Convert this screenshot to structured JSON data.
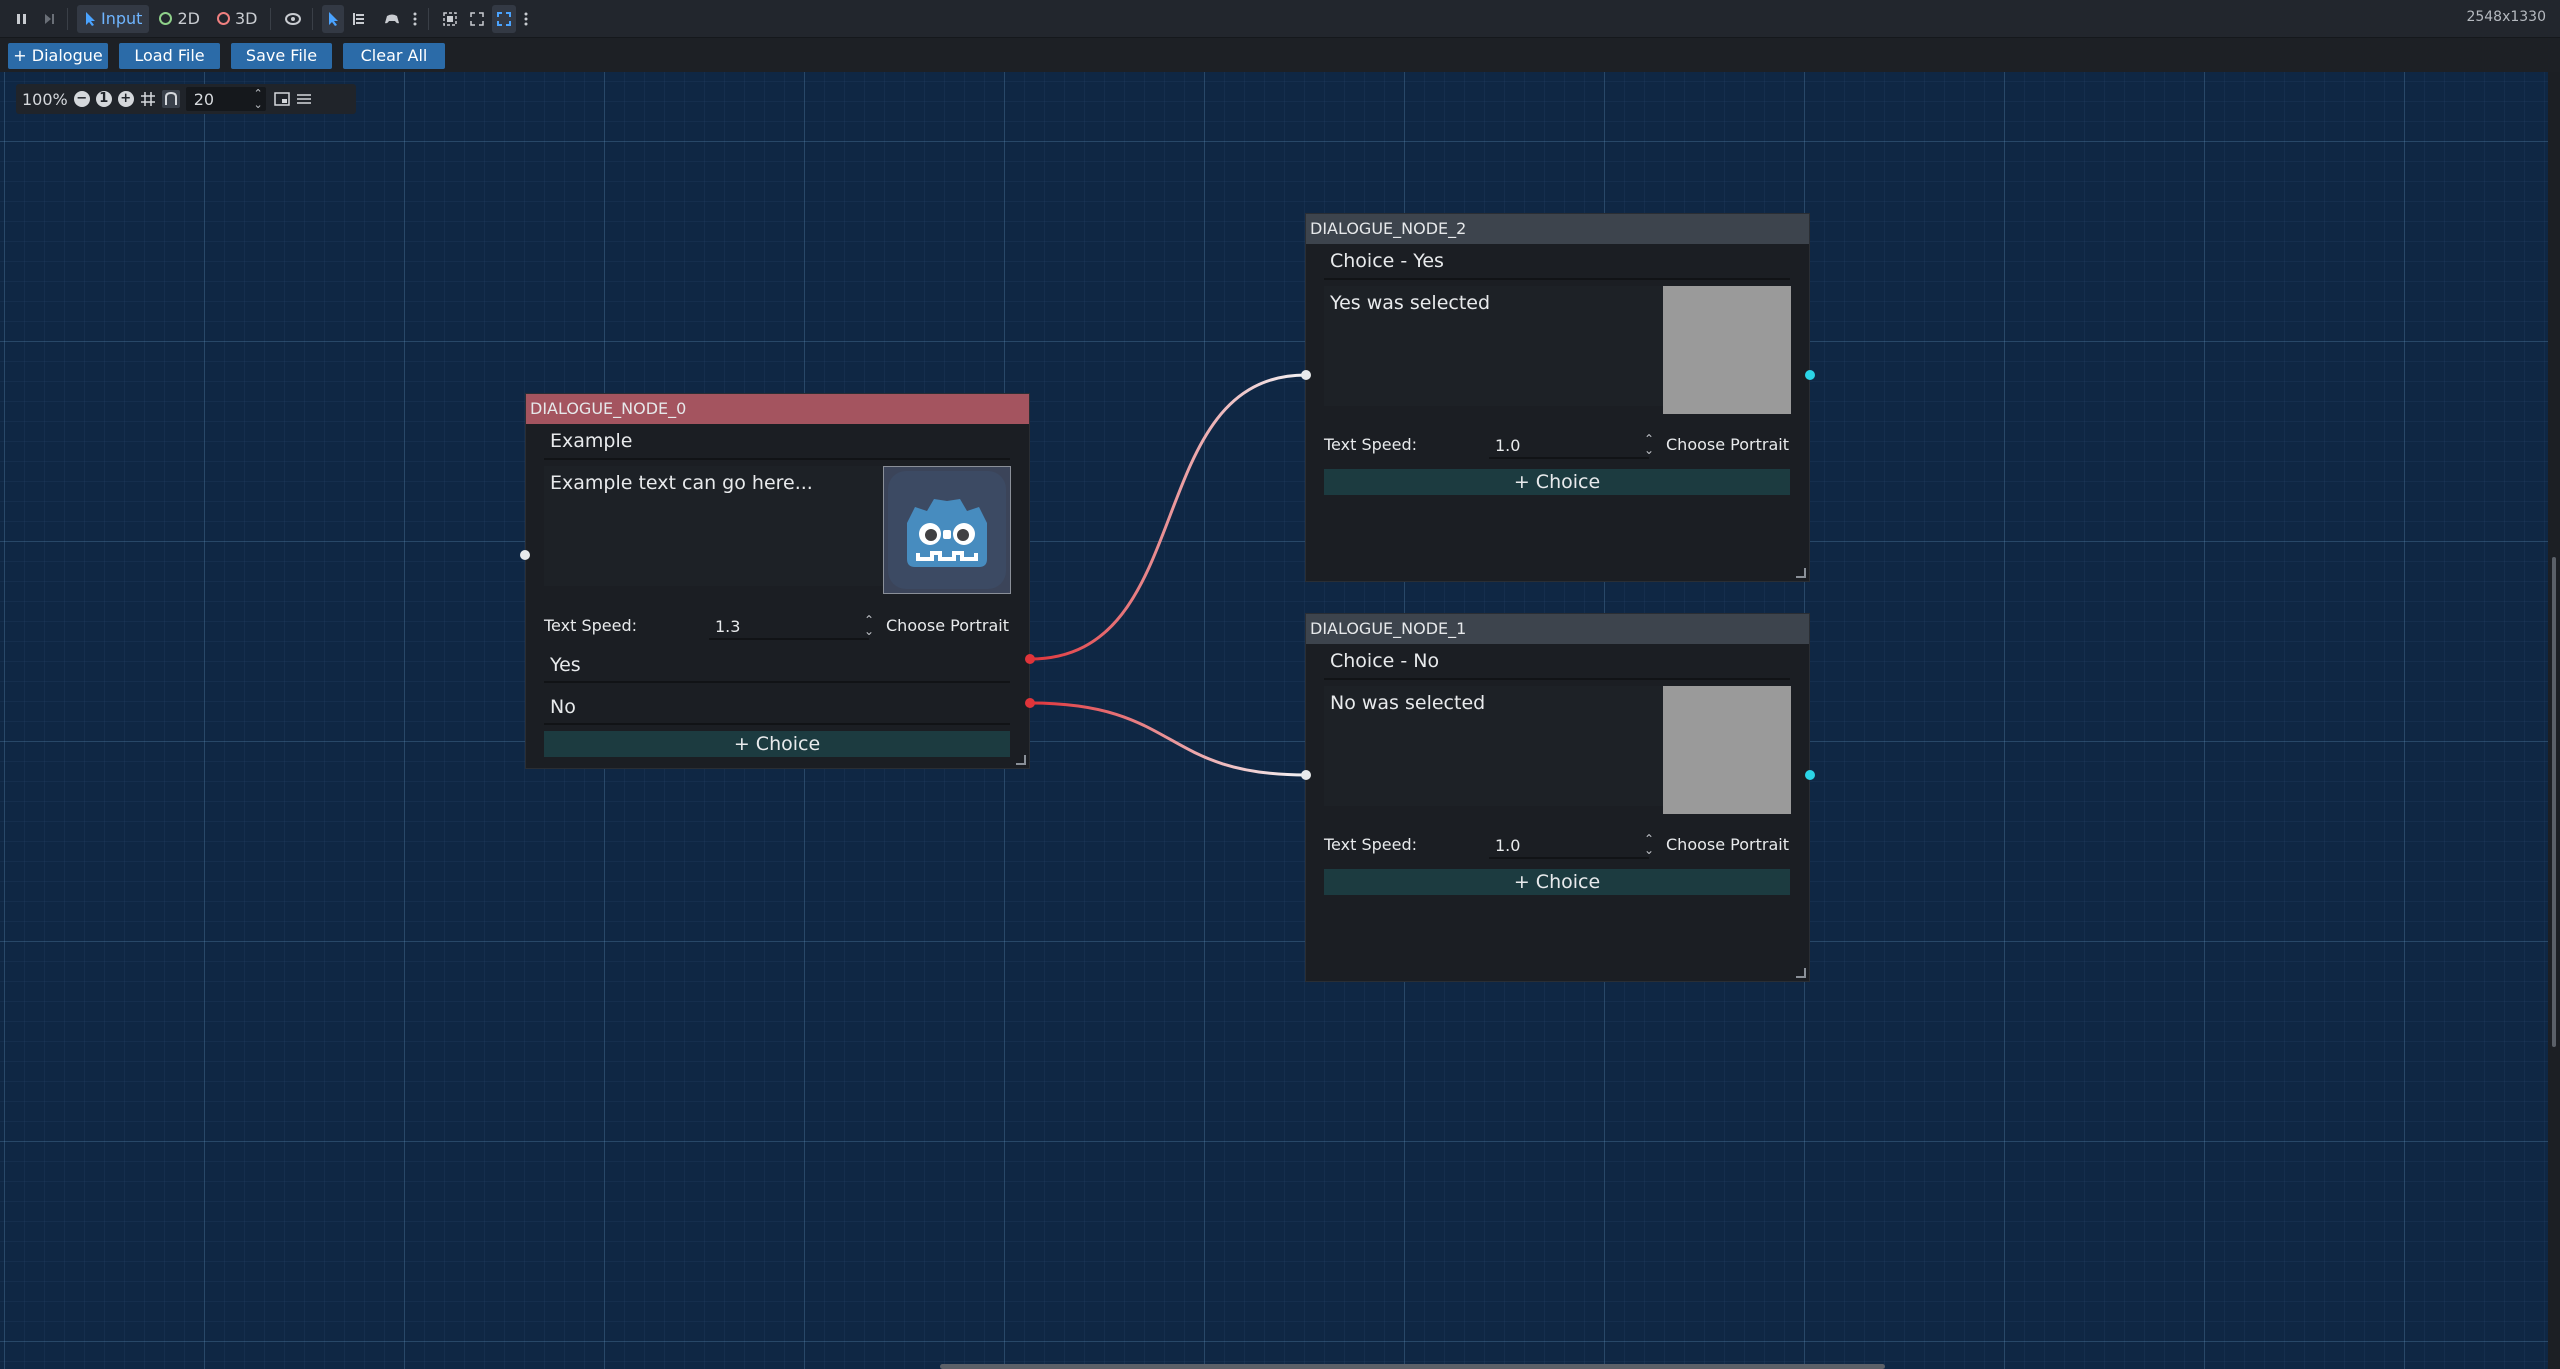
{
  "topbar": {
    "input_label": "Input",
    "mode_2d": "2D",
    "mode_3d": "3D",
    "resolution": "2548x1330",
    "icons": [
      "pause-icon",
      "step-icon",
      "input-pointer-icon",
      "circle-2d-icon",
      "circle-3d-icon",
      "eye-icon",
      "select-arrow-icon",
      "list-icon",
      "game-controller-icon",
      "more-icon",
      "camera-icon",
      "fit-icon",
      "fullscreen-icon",
      "more-icon"
    ],
    "accent": "#4aa3ff"
  },
  "toolbar": {
    "add_dialogue": "+ Dialogue",
    "load_file": "Load File",
    "save_file": "Save File",
    "clear_all": "Clear All"
  },
  "zoom": {
    "level": "100%",
    "snap_distance": "20"
  },
  "nodes": {
    "node0": {
      "title": "DIALOGUE_NODE_0",
      "name": "Example",
      "text": "Example text can go here...",
      "speed_label": "Text Speed:",
      "speed": "1.3",
      "portrait_label": "Choose Portrait",
      "choices": [
        "Yes",
        "No"
      ],
      "add_choice": "+ Choice"
    },
    "node2": {
      "title": "DIALOGUE_NODE_2",
      "name": "Choice - Yes",
      "text": "Yes was selected",
      "speed_label": "Text Speed:",
      "speed": "1.0",
      "portrait_label": "Choose Portrait",
      "add_choice": "+ Choice"
    },
    "node1": {
      "title": "DIALOGUE_NODE_1",
      "name": "Choice - No",
      "text": "No was selected",
      "speed_label": "Text Speed:",
      "speed": "1.0",
      "portrait_label": "Choose Portrait",
      "add_choice": "+ Choice"
    }
  },
  "colors": {
    "canvas_bg": "#0f2744",
    "selected_title": "#a4545f",
    "node_title": "#3d444d",
    "button_blue": "#2b6ba8",
    "choice_button": "#1c3b40",
    "connection_red": "#e0343a",
    "port_cyan": "#2bd4e6"
  }
}
